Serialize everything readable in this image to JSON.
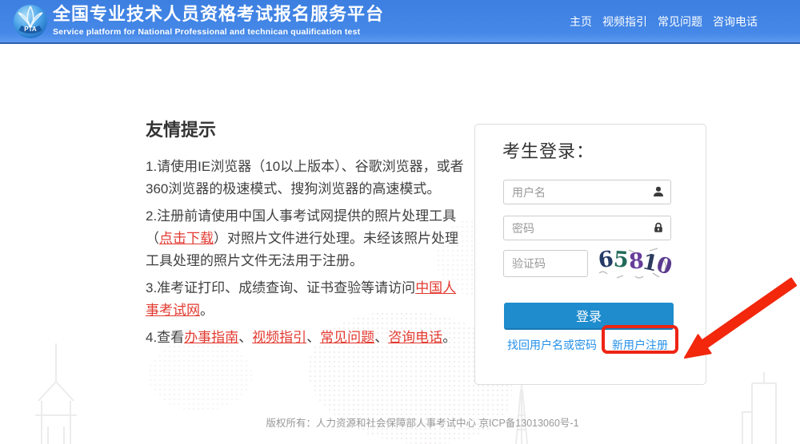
{
  "header": {
    "logo_text": "PTA",
    "title": "全国专业技术人员资格考试报名服务平台",
    "subtitle": "Service platform for National Professional and technican qualification test",
    "nav": [
      {
        "name": "nav-home",
        "label": "主页"
      },
      {
        "name": "nav-video-guide",
        "label": "视频指引"
      },
      {
        "name": "nav-faq",
        "label": "常见问题"
      },
      {
        "name": "nav-hotline",
        "label": "咨询电话"
      }
    ]
  },
  "tips": {
    "heading": "友情提示",
    "paragraphs": [
      [
        {
          "t": "1.请使用IE浏览器（10以上版本）、谷歌浏览器，或者360浏览器的极速模式、搜狗浏览器的高速模式。"
        }
      ],
      [
        {
          "t": "2.注册前请使用中国人事考试网提供的照片处理工具（"
        },
        {
          "t": "点击下载",
          "link": true
        },
        {
          "t": "）对照片文件进行处理。未经该照片处理工具处理的照片文件无法用于注册。"
        }
      ],
      [
        {
          "t": "3.准考证打印、成绩查询、证书查验等请访问"
        },
        {
          "t": "中国人事考试网",
          "link": true
        },
        {
          "t": "。"
        }
      ],
      [
        {
          "t": "4.查看"
        },
        {
          "t": "办事指南",
          "link": true
        },
        {
          "t": "、"
        },
        {
          "t": "视频指引",
          "link": true
        },
        {
          "t": "、"
        },
        {
          "t": "常见问题",
          "link": true
        },
        {
          "t": "、"
        },
        {
          "t": "咨询电话",
          "link": true
        },
        {
          "t": "。"
        }
      ]
    ]
  },
  "login": {
    "title": "考生登录：",
    "username_placeholder": "用户名",
    "password_placeholder": "密码",
    "captcha_placeholder": "验证码",
    "captcha_value": "65810",
    "captcha_digits": [
      {
        "char": "6",
        "color": "#253a66"
      },
      {
        "char": "5",
        "color": "#216a5a"
      },
      {
        "char": "8",
        "color": "#663d99"
      },
      {
        "char": "1",
        "color": "#2c3a5e"
      },
      {
        "char": "0",
        "color": "#5a3a8e"
      }
    ],
    "login_button": "登录",
    "forgot_link": "找回用户名或密码",
    "register_link": "新用户注册"
  },
  "footer": {
    "copyright": "版权所有：人力资源和社会保障部人事考试中心 京ICP备13013060号-1"
  },
  "colors": {
    "header_blue": "#4084e4",
    "button_blue": "#1e8ccd",
    "link_blue": "#2590e9",
    "tip_link_red": "#e23a30",
    "annotation_red": "#ee2414"
  }
}
